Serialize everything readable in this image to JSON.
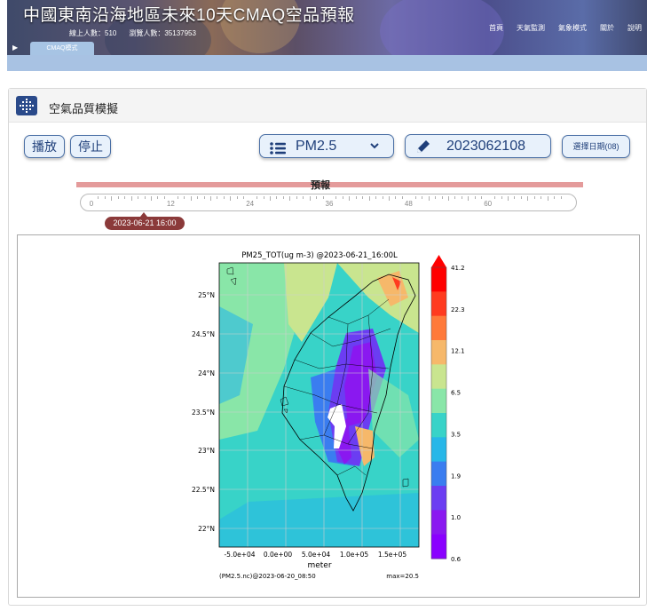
{
  "header": {
    "site_title": "中國東南沿海地區未來10天CMAQ空品預報",
    "online_label": "線上人數：510",
    "visits_label": "瀏覽人數：35137953",
    "nav": [
      "首頁",
      "天氣監測",
      "氣象模式",
      "關於",
      "說明"
    ],
    "menu_toggle": "▶",
    "active_tab": "CMAQ模式"
  },
  "panel": {
    "title": "空氣品質模擬",
    "play_label": "播放",
    "stop_label": "停止",
    "species_selected": "PM2.5",
    "date_value": "2023062108",
    "date_button": "選擇日期(08)"
  },
  "timeline": {
    "section_label": "預報",
    "ticks": [
      "0",
      "12",
      "24",
      "36",
      "48",
      "60"
    ],
    "current_time": "2023-06-21 16:00",
    "current_hour": 8
  },
  "figure": {
    "title": "PM25_TOT(ug m-3) @2023-06-21_16:00L",
    "lat_labels": [
      "25°N",
      "24.5°N",
      "24°N",
      "23.5°N",
      "23°N",
      "22.5°N",
      "22°N"
    ],
    "x_ticks": [
      "-5.0e+04",
      "0.0e+00",
      "5.0e+04",
      "1.0e+05",
      "1.5e+05"
    ],
    "xlabel": "meter",
    "footer_left": "(PM2.5.nc)@2023-06-20_08:50",
    "footer_right": "max=20.5",
    "colorbar_labels": [
      "41.2",
      "22.3",
      "12.1",
      "6.5",
      "3.5",
      "1.9",
      "1.0",
      "0.6"
    ],
    "colorbar_colors": [
      "#ff0000",
      "#ff3b1f",
      "#ff7a3a",
      "#f6b86a",
      "#c9e58f",
      "#89e6a8",
      "#38d3c8",
      "#27b7e8",
      "#3a7df0",
      "#6b3df2",
      "#8a18f0",
      "#8a00ff"
    ]
  },
  "colors": {
    "accent": "#4a6fa5",
    "badge": "#8b3a3a",
    "timeline_bar": "#e49b9b",
    "tab_strip": "#a8c2e3"
  }
}
